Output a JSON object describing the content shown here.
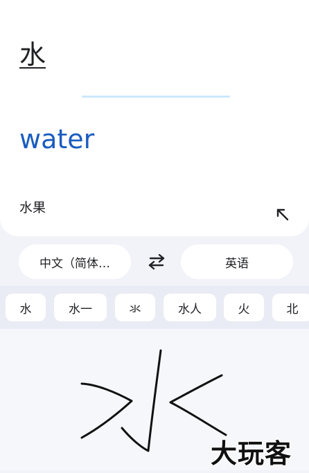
{
  "input": {
    "text": "水"
  },
  "output": {
    "translation": "water"
  },
  "suggestions": [
    "水果"
  ],
  "languages": {
    "source": "中文（简体…",
    "target": "英语"
  },
  "candidates": [
    "水",
    "水一",
    "氺",
    "水人",
    "火",
    "北"
  ],
  "watermark": "大玩客",
  "colors": {
    "accent": "#1a5cbf",
    "divider": "#cde7fa",
    "background": "#f1f3f9"
  },
  "icons": {
    "expand": "arrow-up-left-icon",
    "swap": "swap-arrows-icon"
  }
}
